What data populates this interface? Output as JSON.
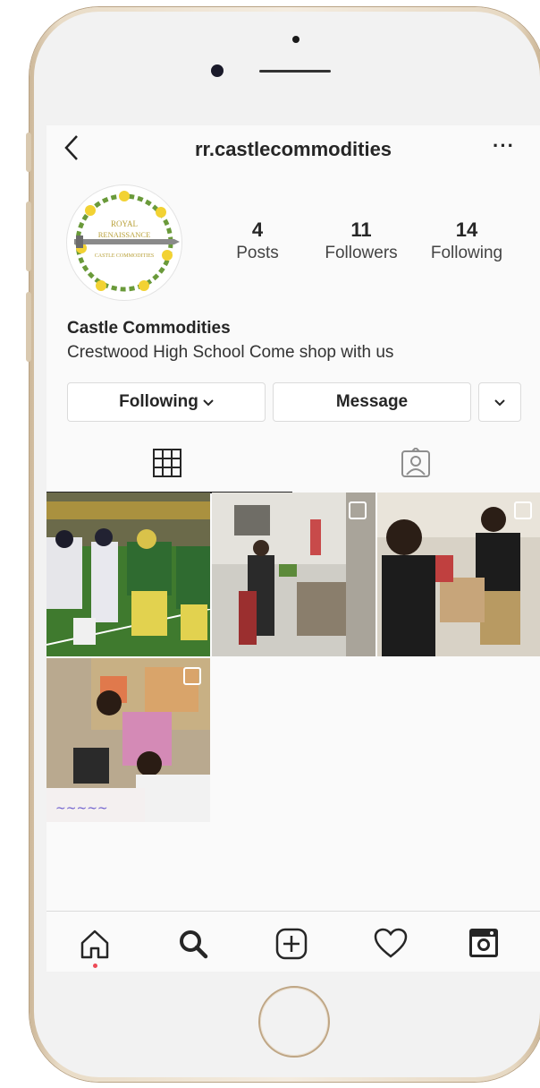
{
  "header": {
    "back_glyph": "‹",
    "username": "rr.castlecommodities",
    "more_glyph": "···"
  },
  "profile": {
    "avatar_logo_line1": "ROYAL",
    "avatar_logo_line2": "RENAISSANCE",
    "avatar_logo_line3": "CASTLE COMMODITIES",
    "stats": [
      {
        "value": "4",
        "label": "Posts"
      },
      {
        "value": "11",
        "label": "Followers"
      },
      {
        "value": "14",
        "label": "Following"
      }
    ],
    "name": "Castle Commodities",
    "bio": "Crestwood High School Come shop with us"
  },
  "actions": {
    "following_label": "Following",
    "following_chevron": "⌄",
    "message_label": "Message",
    "suggest_chevron": "⌄"
  },
  "tabs": [
    {
      "icon": "grid-icon",
      "active": true
    },
    {
      "icon": "tagged-icon",
      "active": false
    }
  ],
  "posts": [
    {
      "icon": "photo-football-game",
      "multiple": false
    },
    {
      "icon": "photo-classroom-student",
      "multiple": true
    },
    {
      "icon": "photo-students-handshake",
      "multiple": true
    },
    {
      "icon": "photo-students-studying",
      "multiple": true
    }
  ],
  "bottom_nav": [
    {
      "icon": "home-icon",
      "active": true
    },
    {
      "icon": "search-icon"
    },
    {
      "icon": "add-post-icon"
    },
    {
      "icon": "heart-icon"
    },
    {
      "icon": "profile-icon"
    }
  ],
  "colors": {
    "text": "#262626",
    "border": "#dbdbdb",
    "notification_dot": "#ed4956",
    "phone_frame": "#e9dcc7",
    "avatar_wreath": "#6a9a3a",
    "avatar_flowers": "#f2d233"
  }
}
